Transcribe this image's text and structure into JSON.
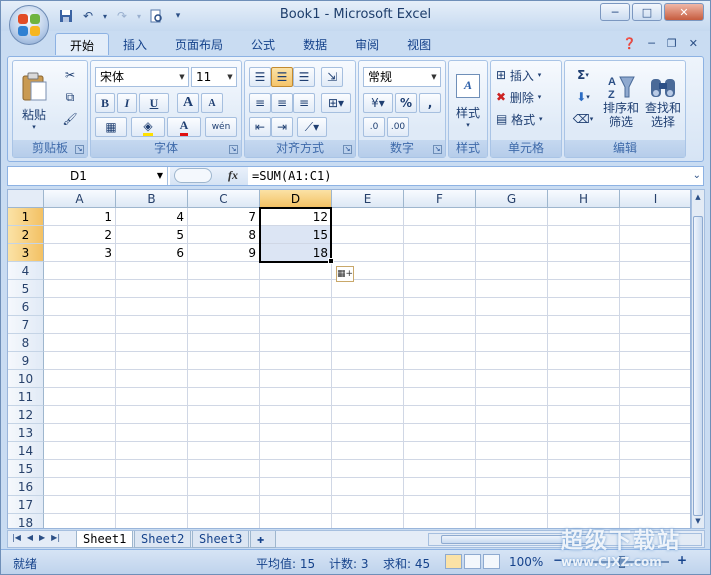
{
  "window": {
    "title": "Book1 - Microsoft Excel",
    "controls": {
      "minimize": "─",
      "maximize": "□",
      "close": "✕"
    }
  },
  "colors": {
    "selection": "#000000",
    "selection_fill": "#dce5f4",
    "header_selected": "#f3c164",
    "ribbon_label": "#3e6aaa"
  },
  "quick_access": [
    {
      "icon": "save-icon",
      "glyph": "▣"
    },
    {
      "icon": "undo-icon",
      "glyph": "↶"
    },
    {
      "icon": "redo-icon",
      "glyph": "↷"
    },
    {
      "icon": "print-preview-icon",
      "glyph": "⎙"
    },
    {
      "icon": "customize-qat-icon",
      "glyph": "▾"
    }
  ],
  "tabs": [
    "开始",
    "插入",
    "页面布局",
    "公式",
    "数据",
    "审阅",
    "视图"
  ],
  "active_tab": "开始",
  "ribbon": {
    "clipboard": {
      "label": "剪贴板",
      "paste": "粘贴"
    },
    "font": {
      "label": "字体",
      "name": "宋体",
      "size": "11",
      "bold": "B",
      "italic": "I",
      "underline": "U",
      "grow": "A",
      "shrink": "A",
      "phonetic": "wén"
    },
    "alignment": {
      "label": "对齐方式"
    },
    "number": {
      "label": "数字",
      "format": "常规",
      "percent": "%",
      "comma": ",",
      "inc_decimal": ".0",
      "dec_decimal": ".00"
    },
    "styles": {
      "label": "样式",
      "button": "样式"
    },
    "cells": {
      "label": "单元格",
      "insert": "插入",
      "delete": "删除",
      "format": "格式"
    },
    "editing": {
      "label": "编辑",
      "sort_filter": "排序和\n筛选",
      "sort_line1": "排序和",
      "sort_line2": "筛选",
      "find_line1": "查找和",
      "find_line2": "选择",
      "sigma": "Σ"
    }
  },
  "formula_bar": {
    "name_box": "D1",
    "fx": "fx",
    "formula": "=SUM(A1:C1)"
  },
  "grid": {
    "columns": [
      "A",
      "B",
      "C",
      "D",
      "E",
      "F",
      "G",
      "H",
      "I"
    ],
    "selected_column": "D",
    "rows": [
      "1",
      "2",
      "3",
      "4",
      "5",
      "6",
      "7",
      "8",
      "9",
      "10",
      "11",
      "12",
      "13",
      "14",
      "15",
      "16",
      "17",
      "18"
    ],
    "selected_rows": [
      "1",
      "2",
      "3"
    ],
    "cells": [
      [
        "1",
        "4",
        "7",
        "12"
      ],
      [
        "2",
        "5",
        "8",
        "15"
      ],
      [
        "3",
        "6",
        "9",
        "18"
      ]
    ]
  },
  "sheets": [
    "Sheet1",
    "Sheet2",
    "Sheet3"
  ],
  "active_sheet": "Sheet1",
  "status": {
    "ready": "就绪",
    "average": "平均值: 15",
    "count": "计数: 3",
    "sum": "求和: 45",
    "zoom": "100%",
    "zoom_out": "−",
    "zoom_in": "+"
  },
  "watermark": {
    "title": "超级下载站",
    "url": "www.CJXZ.com"
  }
}
